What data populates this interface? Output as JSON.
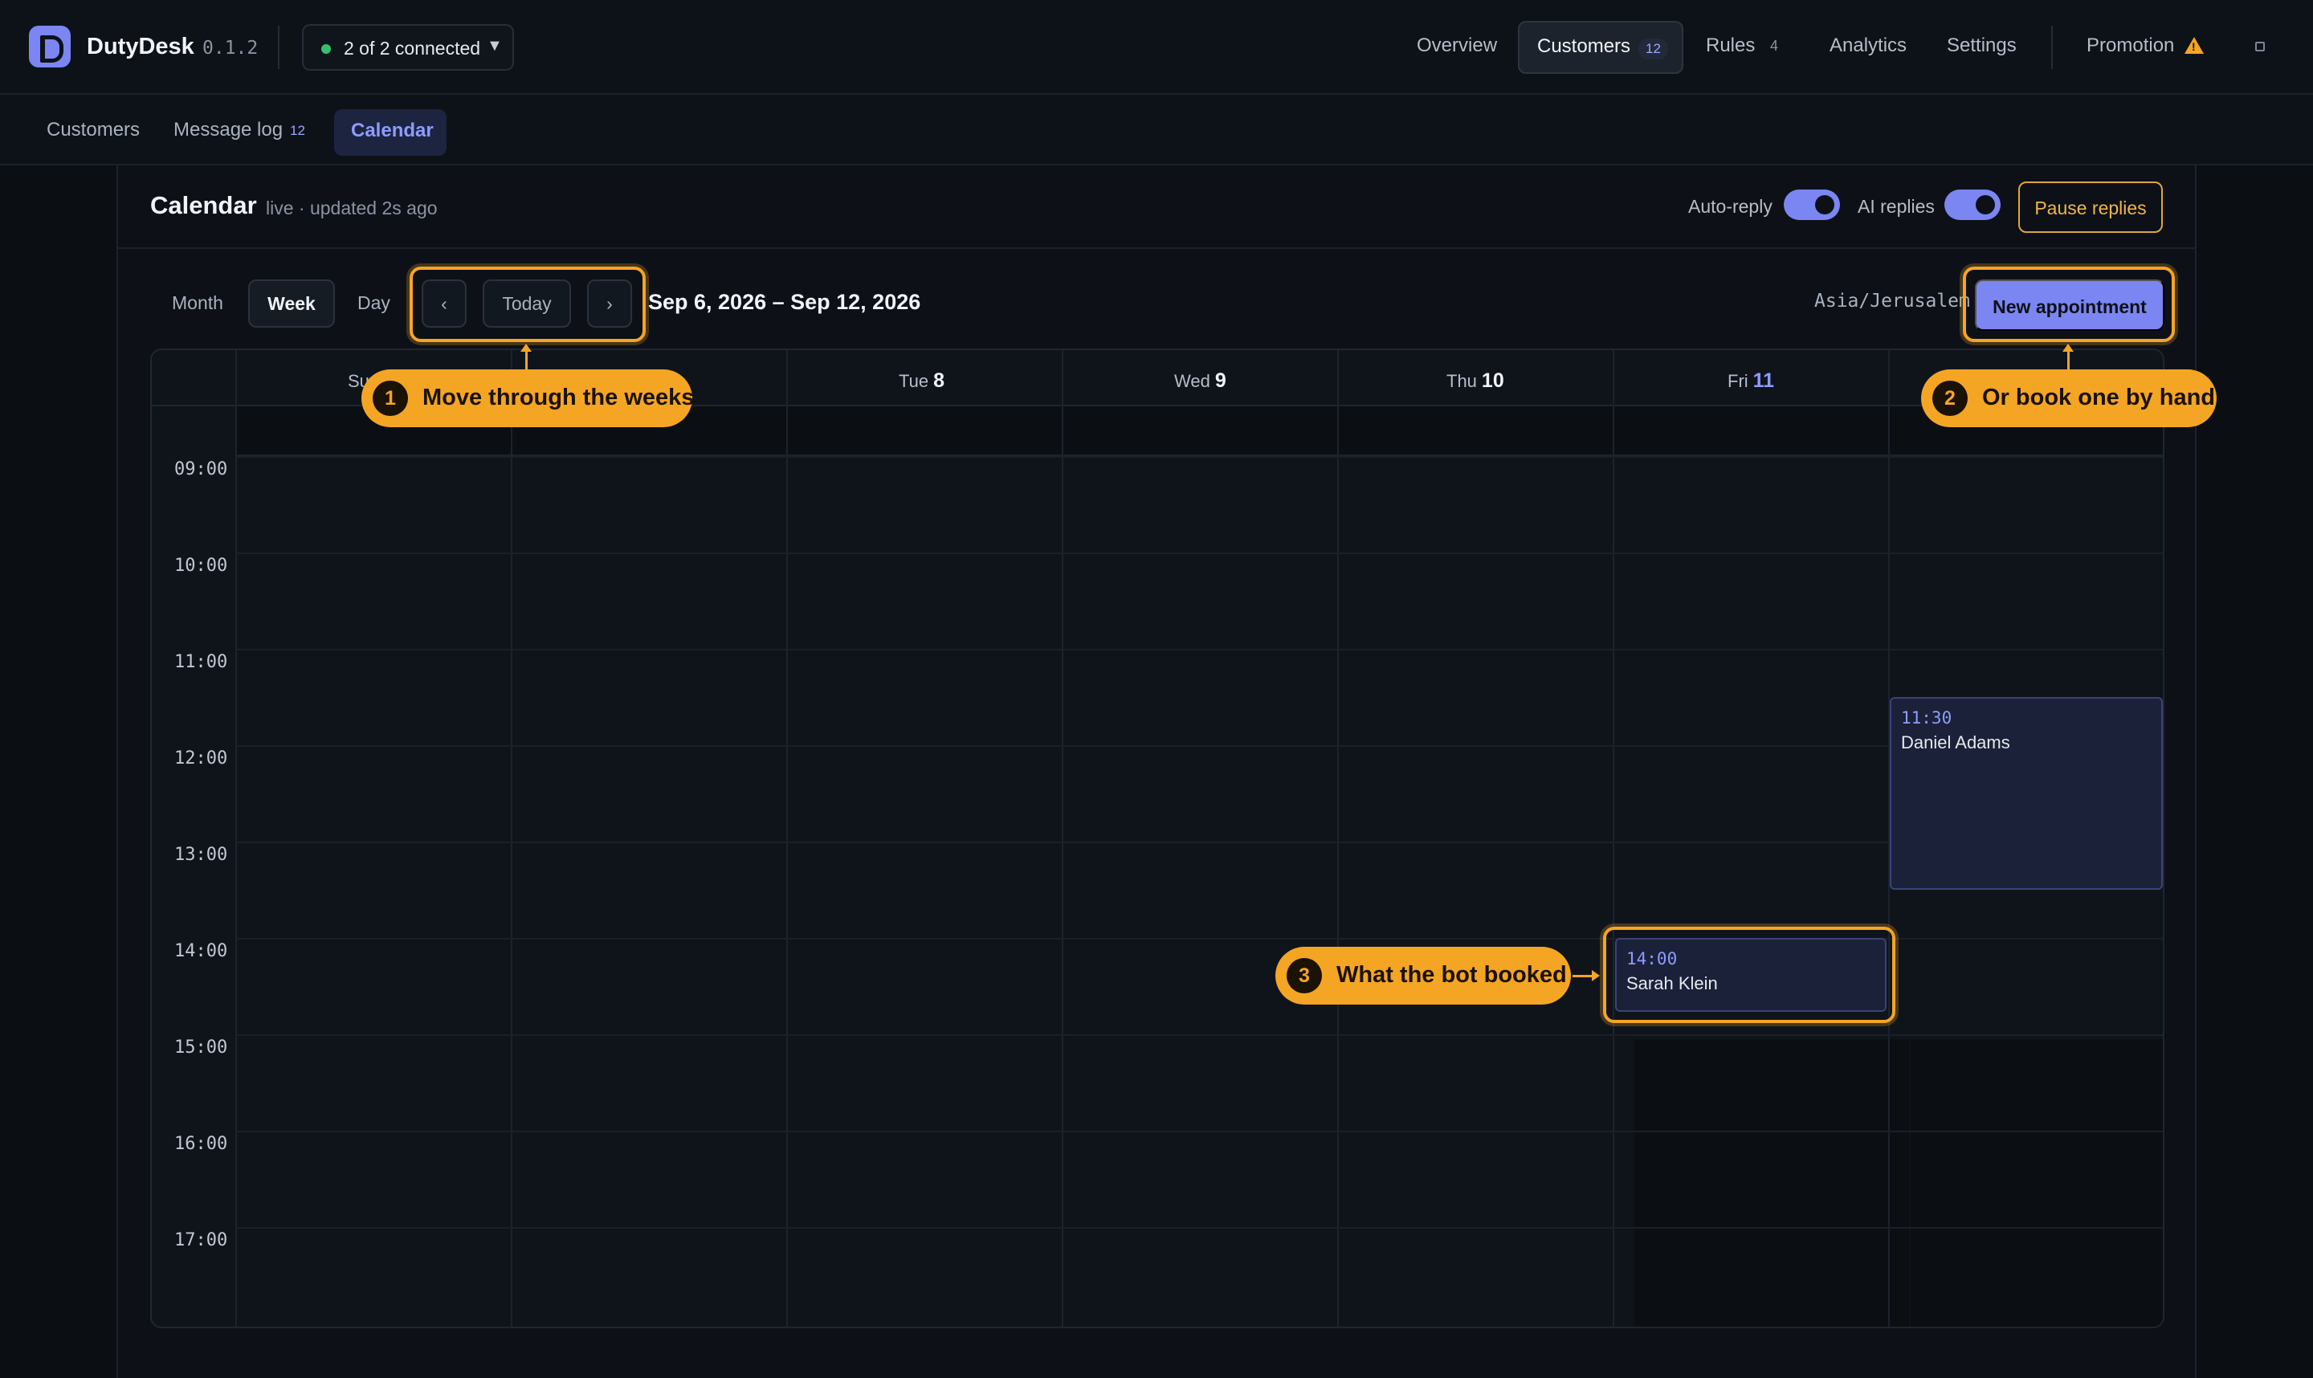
{
  "app": {
    "name": "DutyDesk",
    "version": "0.1.2",
    "connection_status": "2 of 2 connected",
    "accent_color": "#7b86f2",
    "highlight_color": "#f5a524"
  },
  "nav": {
    "overview": "Overview",
    "customers": "Customers",
    "customers_count": "12",
    "rules": "Rules",
    "rules_count": "4",
    "analytics": "Analytics",
    "settings": "Settings",
    "promotion": "Promotion"
  },
  "subtabs": {
    "customers": "Customers",
    "message_log": "Message log",
    "message_log_count": "12",
    "calendar": "Calendar"
  },
  "panel": {
    "title": "Calendar",
    "subtitle": "live · updated 2s ago",
    "auto_reply_label": "Auto-reply",
    "ai_replies_label": "AI replies",
    "pause_label": "Pause replies"
  },
  "toolbar": {
    "view_month": "Month",
    "view_week": "Week",
    "view_day": "Day",
    "prev": "‹",
    "today": "Today",
    "next": "›",
    "date_range": "Sep 6, 2026 – Sep 12, 2026",
    "timezone": "Asia/Jerusalem",
    "new_appointment": "New appointment"
  },
  "calendar": {
    "days": [
      {
        "name": "Su",
        "num": ""
      },
      {
        "name": "",
        "num": ""
      },
      {
        "name": "Tue",
        "num": "8"
      },
      {
        "name": "Wed",
        "num": "9"
      },
      {
        "name": "Thu",
        "num": "10"
      },
      {
        "name": "Fri",
        "num": "11"
      },
      {
        "name": "",
        "num": ""
      }
    ],
    "hours": [
      "09:00",
      "10:00",
      "11:00",
      "12:00",
      "13:00",
      "14:00",
      "15:00",
      "16:00",
      "17:00"
    ],
    "events": [
      {
        "time": "11:30",
        "name": "Daniel Adams"
      },
      {
        "time": "14:00",
        "name": "Sarah Klein"
      }
    ]
  },
  "callouts": {
    "c1_num": "1",
    "c1_text": "Move through the weeks",
    "c2_num": "2",
    "c2_text": "Or book one by hand",
    "c3_num": "3",
    "c3_text": "What the bot booked"
  }
}
